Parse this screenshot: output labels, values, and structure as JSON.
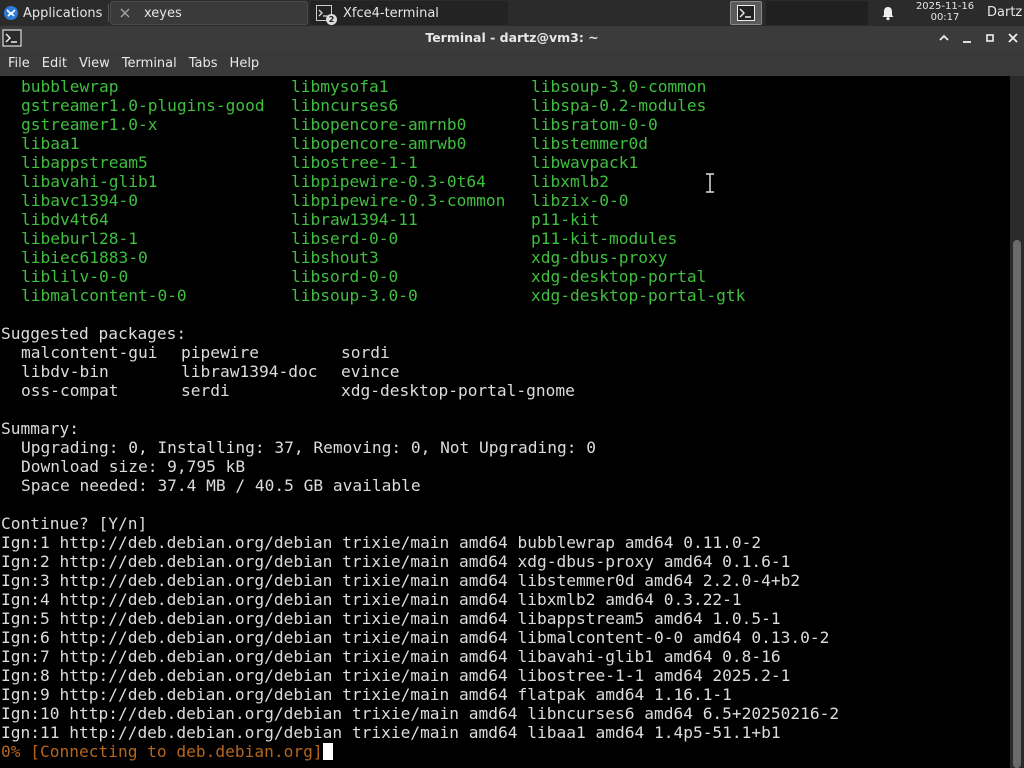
{
  "panel": {
    "applications": "Applications",
    "tasks": [
      {
        "label": "xeyes"
      },
      {
        "label": "Xfce4-terminal",
        "badge": "2"
      }
    ],
    "clock_date": "2025-11-16",
    "clock_time": "00:17",
    "user": "Dartz"
  },
  "window": {
    "title": "Terminal - dartz@vm3: ~"
  },
  "menu": [
    "File",
    "Edit",
    "View",
    "Terminal",
    "Tabs",
    "Help"
  ],
  "packages": {
    "col1": [
      "bubblewrap",
      "gstreamer1.0-plugins-good",
      "gstreamer1.0-x",
      "libaa1",
      "libappstream5",
      "libavahi-glib1",
      "libavc1394-0",
      "libdv4t64",
      "libeburl28-1",
      "libiec61883-0",
      "liblilv-0-0",
      "libmalcontent-0-0"
    ],
    "col2": [
      "libmysofa1",
      "libncurses6",
      "libopencore-amrnb0",
      "libopencore-amrwb0",
      "libostree-1-1",
      "libpipewire-0.3-0t64",
      "libpipewire-0.3-common",
      "libraw1394-11",
      "libserd-0-0",
      "libshout3",
      "libsord-0-0",
      "libsoup-3.0-0"
    ],
    "col3": [
      "libsoup-3.0-common",
      "libspa-0.2-modules",
      "libsratom-0-0",
      "libstemmer0d",
      "libwavpack1",
      "libxmlb2",
      "libzix-0-0",
      "p11-kit",
      "p11-kit-modules",
      "xdg-dbus-proxy",
      "xdg-desktop-portal",
      "xdg-desktop-portal-gtk"
    ]
  },
  "suggested": {
    "header": "Suggested packages:",
    "col1": [
      "malcontent-gui",
      "libdv-bin",
      "oss-compat"
    ],
    "col2": [
      "pipewire",
      "libraw1394-doc",
      "serdi"
    ],
    "col3": [
      "sordi",
      "evince",
      "xdg-desktop-portal-gnome"
    ]
  },
  "summary": {
    "header": "Summary:",
    "lines": [
      "Upgrading: 0, Installing: 37, Removing: 0, Not Upgrading: 0",
      "Download size: 9,795 kB",
      "Space needed: 37.4 MB / 40.5 GB available"
    ]
  },
  "prompt": "Continue? [Y/n]",
  "ign_lines": [
    "Ign:1 http://deb.debian.org/debian trixie/main amd64 bubblewrap amd64 0.11.0-2",
    "Ign:2 http://deb.debian.org/debian trixie/main amd64 xdg-dbus-proxy amd64 0.1.6-1",
    "Ign:3 http://deb.debian.org/debian trixie/main amd64 libstemmer0d amd64 2.2.0-4+b2",
    "Ign:4 http://deb.debian.org/debian trixie/main amd64 libxmlb2 amd64 0.3.22-1",
    "Ign:5 http://deb.debian.org/debian trixie/main amd64 libappstream5 amd64 1.0.5-1",
    "Ign:6 http://deb.debian.org/debian trixie/main amd64 libmalcontent-0-0 amd64 0.13.0-2",
    "Ign:7 http://deb.debian.org/debian trixie/main amd64 libavahi-glib1 amd64 0.8-16",
    "Ign:8 http://deb.debian.org/debian trixie/main amd64 libostree-1-1 amd64 2025.2-1",
    "Ign:9 http://deb.debian.org/debian trixie/main amd64 flatpak amd64 1.16.1-1",
    "Ign:10 http://deb.debian.org/debian trixie/main amd64 libncurses6 amd64 6.5+20250216-2",
    "Ign:11 http://deb.debian.org/debian trixie/main amd64 libaa1 amd64 1.4p5-51.1+b1"
  ],
  "progress": "0% [Connecting to deb.debian.org]",
  "colors": {
    "package_green": "#3fbf3f",
    "progress_orange": "#b5651d",
    "terminal_bg": "#000000"
  }
}
